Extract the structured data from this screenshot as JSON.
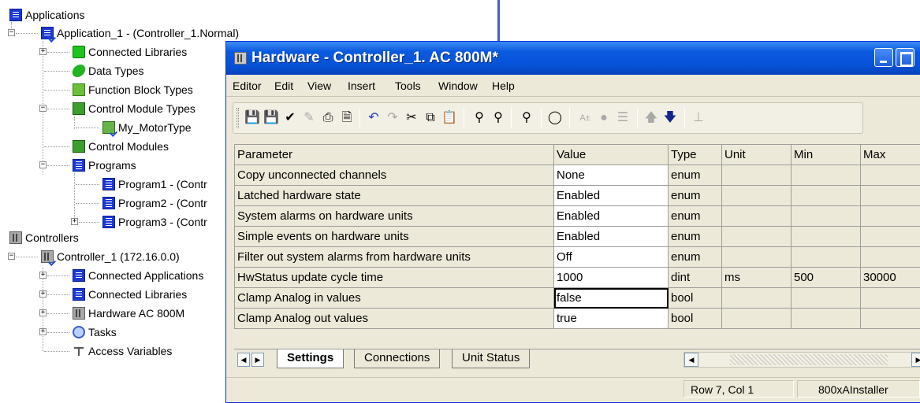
{
  "tree": {
    "applications": "Applications",
    "application_1": "Application_1 - (Controller_1.Normal)",
    "connected_libraries": "Connected Libraries",
    "data_types": "Data Types",
    "function_block_types": "Function Block Types",
    "control_module_types": "Control Module Types",
    "my_motortype": "My_MotorType",
    "control_modules": "Control Modules",
    "programs": "Programs",
    "program1": "Program1 - (Contr",
    "program2": "Program2 - (Contr",
    "program3": "Program3 - (Contr",
    "controllers": "Controllers",
    "controller_1": "Controller_1 (172.16.0.0)",
    "connected_applications": "Connected Applications",
    "connected_libraries_2": "Connected Libraries",
    "hardware": "Hardware  AC 800M",
    "tasks": "Tasks",
    "access_variables": "Access Variables"
  },
  "window": {
    "title": "Hardware - Controller_1.  AC 800M*"
  },
  "menu": [
    "Editor",
    "Edit",
    "View",
    "Insert",
    "Tools",
    "Window",
    "Help"
  ],
  "toolbar_icons": [
    "save-icon",
    "save-all-icon",
    "check-icon",
    "pen-icon",
    "print-icon",
    "print-preview-icon",
    "undo-icon",
    "redo-icon",
    "cut-icon",
    "copy-icon",
    "paste-icon",
    "find-icon",
    "find-replace-icon",
    "find-next-icon",
    "comment-icon",
    "text-icon",
    "dot-icon",
    "tree-icon",
    "up-arrow-icon",
    "down-arrow-icon",
    "connect-icon"
  ],
  "grid": {
    "headers": {
      "parameter": "Parameter",
      "value": "Value",
      "type": "Type",
      "unit": "Unit",
      "min": "Min",
      "max": "Max"
    },
    "rows": [
      {
        "parameter": "Copy unconnected channels",
        "value": "None",
        "type": "enum",
        "unit": "",
        "min": "",
        "max": ""
      },
      {
        "parameter": "Latched hardware state",
        "value": "Enabled",
        "type": "enum",
        "unit": "",
        "min": "",
        "max": ""
      },
      {
        "parameter": "System alarms on hardware units",
        "value": "Enabled",
        "type": "enum",
        "unit": "",
        "min": "",
        "max": ""
      },
      {
        "parameter": "Simple events on hardware units",
        "value": "Enabled",
        "type": "enum",
        "unit": "",
        "min": "",
        "max": ""
      },
      {
        "parameter": "Filter out system alarms from hardware units",
        "value": "Off",
        "type": "enum",
        "unit": "",
        "min": "",
        "max": ""
      },
      {
        "parameter": "HwStatus update cycle time",
        "value": "1000",
        "type": "dint",
        "unit": "ms",
        "min": "500",
        "max": "30000"
      },
      {
        "parameter": "Clamp Analog in values",
        "value": "false",
        "type": "bool",
        "unit": "",
        "min": "",
        "max": ""
      },
      {
        "parameter": "Clamp Analog out values",
        "value": "true",
        "type": "bool",
        "unit": "",
        "min": "",
        "max": ""
      }
    ]
  },
  "tabs": {
    "settings": "Settings",
    "connections": "Connections",
    "unit_status": "Unit Status"
  },
  "status": {
    "position": "Row 7, Col 1",
    "user": "800xAInstaller"
  }
}
